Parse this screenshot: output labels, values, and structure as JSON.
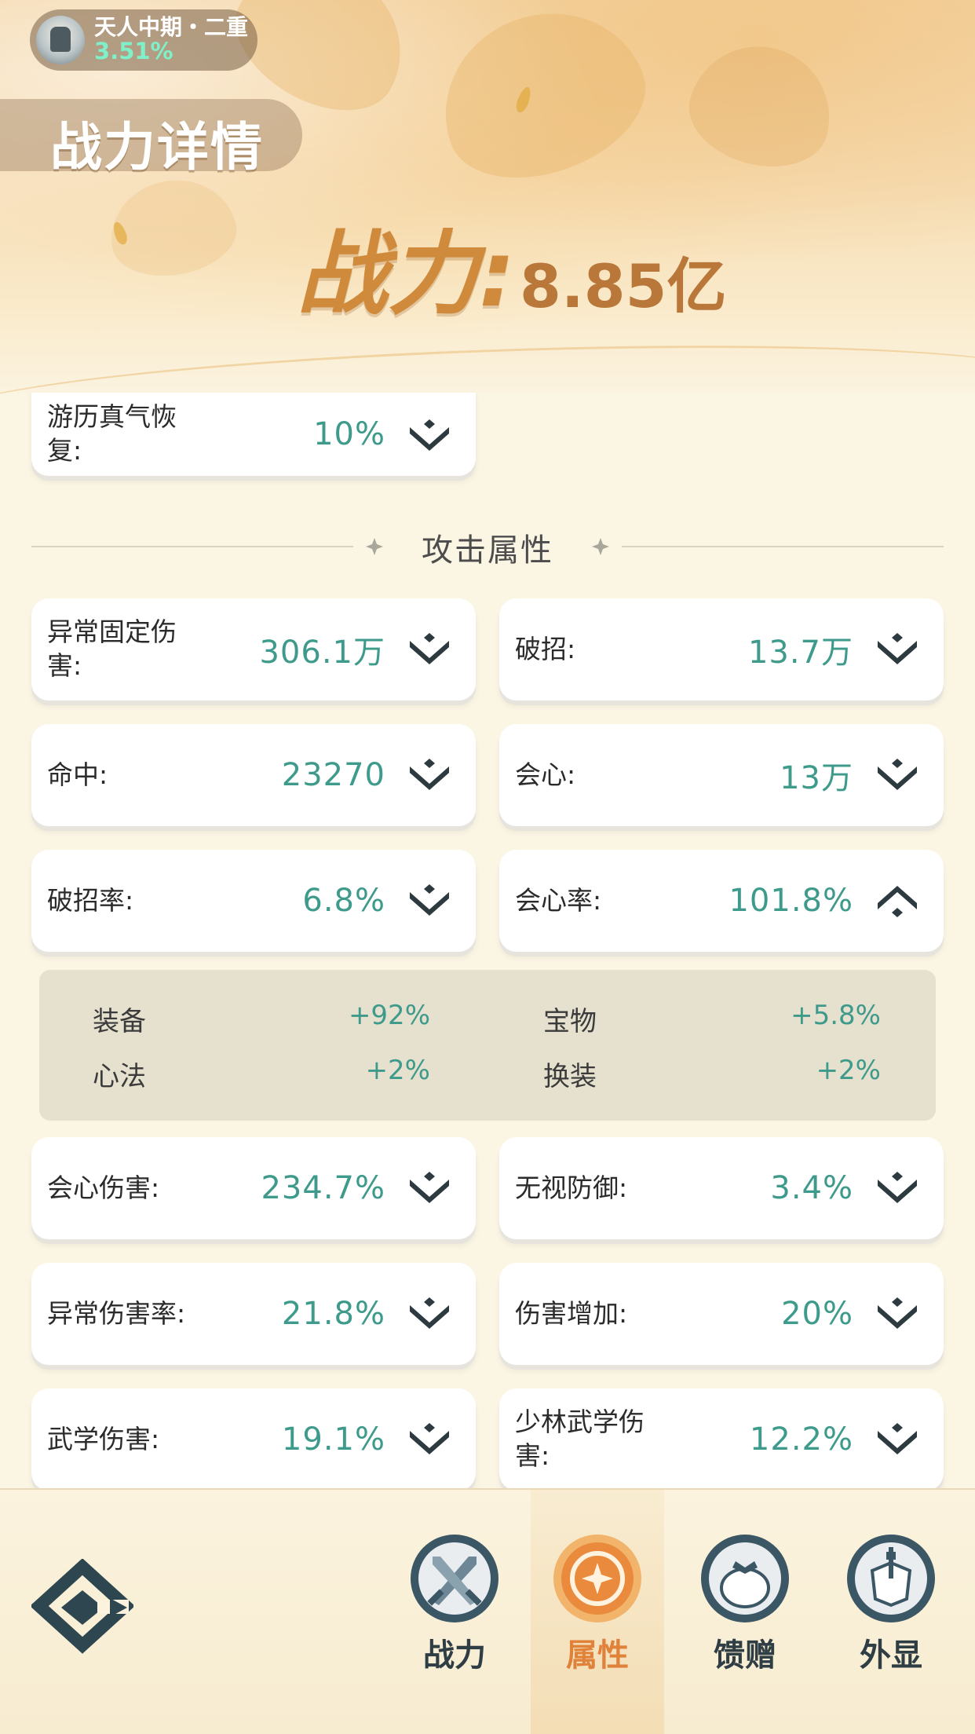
{
  "header": {
    "realm_name": "天人中期・二重",
    "realm_progress": "3.51%",
    "page_title": "战力详情",
    "power_label": "战力:",
    "power_value": "8.85亿"
  },
  "stats_top": [
    {
      "label": "游历真气恢复:",
      "value": "10%"
    }
  ],
  "section_attack_title": "攻击属性",
  "attack_stats": [
    {
      "label": "异常固定伤害:",
      "value": "306.1万",
      "expanded": false
    },
    {
      "label": "破招:",
      "value": "13.7万",
      "expanded": false
    },
    {
      "label": "命中:",
      "value": "23270",
      "expanded": false
    },
    {
      "label": "会心:",
      "value": "13万",
      "expanded": false
    },
    {
      "label": "破招率:",
      "value": "6.8%",
      "expanded": false
    },
    {
      "label": "会心率:",
      "value": "101.8%",
      "expanded": true
    },
    {
      "label": "会心伤害:",
      "value": "234.7%",
      "expanded": false
    },
    {
      "label": "无视防御:",
      "value": "3.4%",
      "expanded": false
    },
    {
      "label": "异常伤害率:",
      "value": "21.8%",
      "expanded": false
    },
    {
      "label": "伤害增加:",
      "value": "20%",
      "expanded": false
    },
    {
      "label": "武学伤害:",
      "value": "19.1%",
      "expanded": false
    },
    {
      "label": "少林武学伤害:",
      "value": "12.2%",
      "expanded": false
    }
  ],
  "crit_rate_breakdown": [
    {
      "name": "装备",
      "value": "+92%"
    },
    {
      "name": "宝物",
      "value": "+5.8%"
    },
    {
      "name": "心法",
      "value": "+2%"
    },
    {
      "name": "换装",
      "value": "+2%"
    }
  ],
  "bottom_tabs": [
    {
      "label": "战力",
      "icon": "crossed-swords-icon",
      "active": false
    },
    {
      "label": "属性",
      "icon": "attribute-shield-icon",
      "active": true
    },
    {
      "label": "馈赠",
      "icon": "gift-bag-icon",
      "active": false
    },
    {
      "label": "外显",
      "icon": "armor-icon",
      "active": false
    }
  ],
  "colors": {
    "value_teal": "#3e9a8b",
    "active_tab_orange": "#e0823a",
    "power_orange": "#d08a3c"
  }
}
